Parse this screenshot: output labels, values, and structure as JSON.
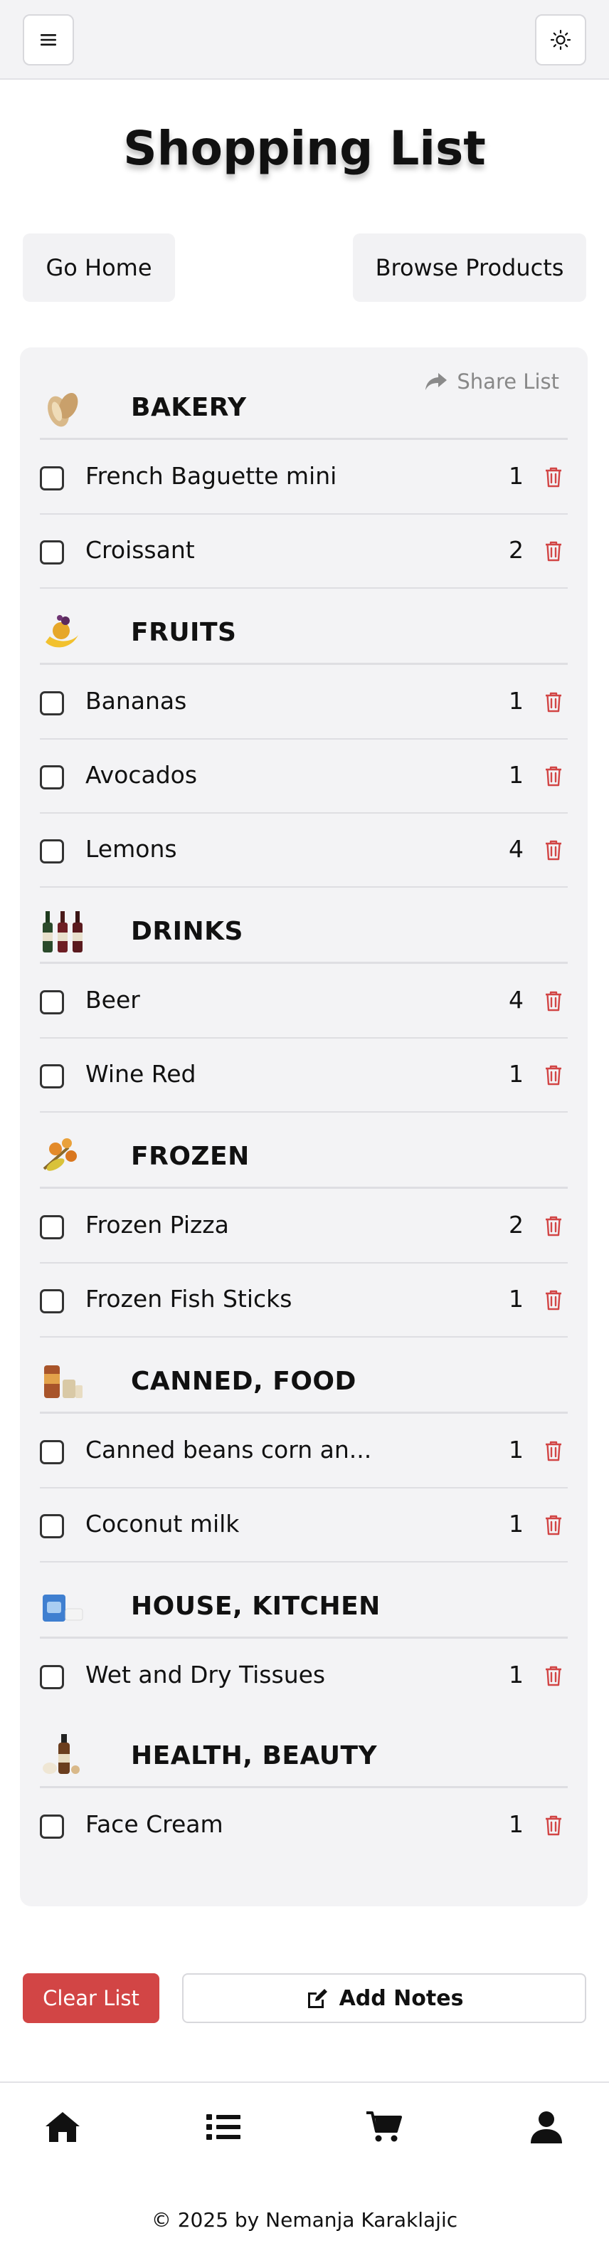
{
  "page": {
    "title": "Shopping List"
  },
  "nav": {
    "go_home": "Go Home",
    "browse_products": "Browse Products"
  },
  "list": {
    "share_label": "Share List",
    "categories": [
      {
        "name": "BAKERY",
        "image": "bread-icon",
        "items": [
          {
            "name": "French Baguette mini",
            "qty": "1"
          },
          {
            "name": "Croissant",
            "qty": "2"
          }
        ]
      },
      {
        "name": "FRUITS",
        "image": "fruit-icon",
        "items": [
          {
            "name": "Bananas",
            "qty": "1"
          },
          {
            "name": "Avocados",
            "qty": "1"
          },
          {
            "name": "Lemons",
            "qty": "4"
          }
        ]
      },
      {
        "name": "DRINKS",
        "image": "wine-bottles-icon",
        "items": [
          {
            "name": "Beer",
            "qty": "4"
          },
          {
            "name": "Wine Red",
            "qty": "1"
          }
        ]
      },
      {
        "name": "FROZEN",
        "image": "frozen-food-icon",
        "items": [
          {
            "name": "Frozen Pizza",
            "qty": "2"
          },
          {
            "name": "Frozen Fish Sticks",
            "qty": "1"
          }
        ]
      },
      {
        "name": "CANNED, FOOD",
        "image": "canned-food-icon",
        "items": [
          {
            "name": "Canned beans corn an...",
            "qty": "1"
          },
          {
            "name": "Coconut milk",
            "qty": "1"
          }
        ]
      },
      {
        "name": "HOUSE, KITCHEN",
        "image": "tissues-icon",
        "items": [
          {
            "name": "Wet and Dry Tissues",
            "qty": "1"
          }
        ]
      },
      {
        "name": "HEALTH, BEAUTY",
        "image": "beauty-products-icon",
        "items": [
          {
            "name": "Face Cream",
            "qty": "1"
          }
        ]
      }
    ]
  },
  "actions": {
    "clear": "Clear List",
    "notes": "Add Notes"
  },
  "bottom_nav": [
    "home-icon",
    "list-icon",
    "cart-icon",
    "user-icon"
  ],
  "footer": "© 2025 by Nemanja Karaklajic",
  "colors": {
    "danger": "#d24545",
    "background": "#f3f3f5",
    "muted": "#888888"
  }
}
